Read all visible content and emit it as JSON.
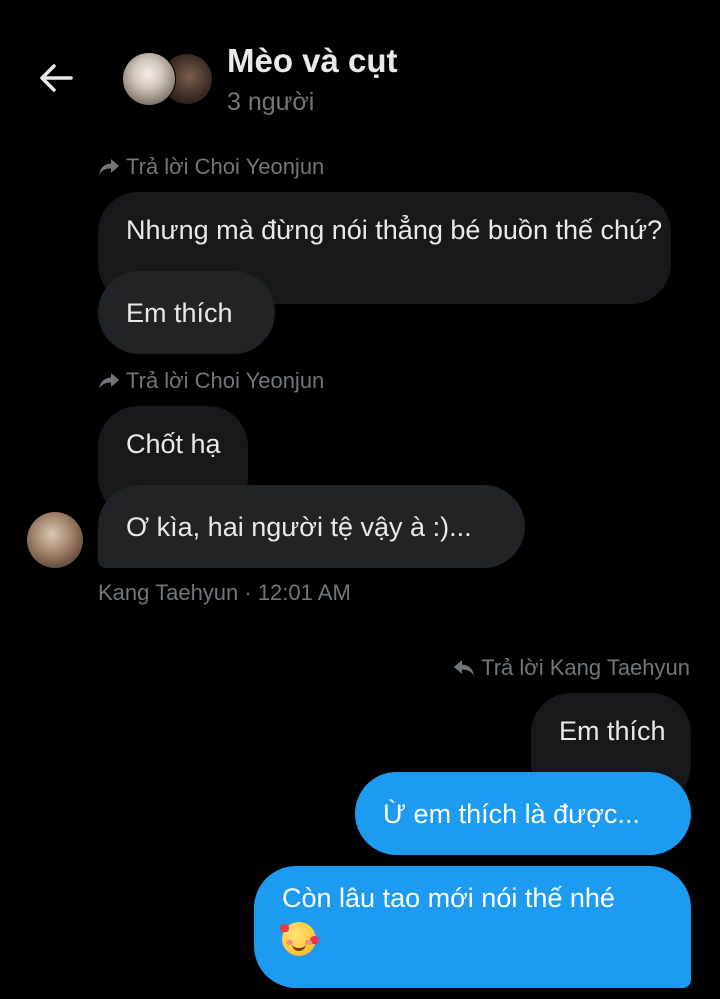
{
  "header": {
    "title": "Mèo và cụt",
    "subtitle": "3 người",
    "back_icon": "arrow-left-icon"
  },
  "messages": {
    "reply1": {
      "label": "Trả lời Choi Yeonjun"
    },
    "ctx1": {
      "text": "Nhưng mà đừng nói thẳng bé buồn thế chứ?"
    },
    "msg1": {
      "text": "Em thích"
    },
    "reply2": {
      "label": "Trả lời Choi Yeonjun"
    },
    "ctx2": {
      "text": "Chốt hạ"
    },
    "msg2": {
      "text": "Ơ kìa, hai người tệ vậy à :)..."
    },
    "meta": "Kang Taehyun · 12:01 AM",
    "reply3": {
      "label": "Trả lời Kang Taehyun"
    },
    "ctx3": {
      "text": "Em thích"
    },
    "out1": {
      "text": "Ừ em thích là được..."
    },
    "out2": {
      "text": "Còn lâu tao mới nói thế nhé",
      "emoji": "smiling-face-with-hearts"
    }
  },
  "colors": {
    "background": "#000000",
    "incoming_bubble": "#202327",
    "outgoing_bubble": "#1d9bf0",
    "secondary_text": "#71767b"
  }
}
